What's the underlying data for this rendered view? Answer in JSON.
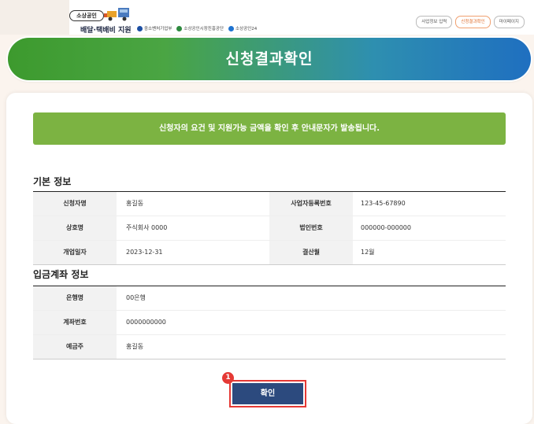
{
  "header": {
    "badge": "소상공인",
    "program_title": "배달·택배비 지원",
    "partners": [
      "중소벤처기업부",
      "소상공인시장진흥공단",
      "소상공인24"
    ],
    "util_links": [
      "사업정보 입력",
      "신청결과확인",
      "마이페이지"
    ]
  },
  "banner": {
    "title": "신청결과확인"
  },
  "notice": "신청자의 요건 및 지원가능 금액을 확인 후 안내문자가 발송됩니다.",
  "basic": {
    "title": "기본 정보",
    "rows": [
      {
        "l1": "신청자명",
        "v1": "홍길동",
        "l2": "사업자등록번호",
        "v2": "123-45-67890"
      },
      {
        "l1": "상호명",
        "v1": "주식회사 0000",
        "l2": "법인번호",
        "v2": "000000-000000"
      },
      {
        "l1": "개업일자",
        "v1": "2023-12-31",
        "l2": "결산월",
        "v2": "12월"
      }
    ]
  },
  "account": {
    "title": "입금계좌 정보",
    "rows": [
      {
        "l": "은행명",
        "v": "00은행"
      },
      {
        "l": "계좌번호",
        "v": "0000000000"
      },
      {
        "l": "예금주",
        "v": "홍길동"
      }
    ]
  },
  "confirm_label": "확인",
  "step_badge": "1",
  "colors": {
    "banner_start": "#3d9a2e",
    "banner_end": "#1f6fc0",
    "notice": "#7cb342",
    "button": "#2c4a7e",
    "highlight": "#e53935"
  }
}
